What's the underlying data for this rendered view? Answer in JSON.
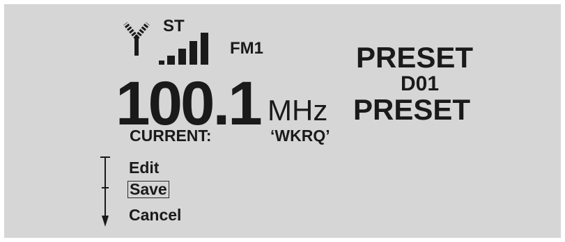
{
  "status": {
    "stereo": "ST",
    "band": "FM1",
    "antenna_icon": "antenna-icon",
    "signal_icon": "signal-strength-icon"
  },
  "tuner": {
    "frequency": "100.1",
    "unit": "MHz",
    "current_label": "CURRENT:",
    "station": "‘WKRQ’"
  },
  "preset": {
    "title": "PRESET",
    "code": "D01",
    "title2": "PRESET"
  },
  "menu": {
    "items": [
      {
        "label": "Edit"
      },
      {
        "label": "Save",
        "selected": true
      },
      {
        "label": "Cancel"
      }
    ],
    "scroll_icon": "scroll-arrow-icon"
  },
  "colors": {
    "screen": "#d6d6d6",
    "text": "#1a1a1a"
  }
}
